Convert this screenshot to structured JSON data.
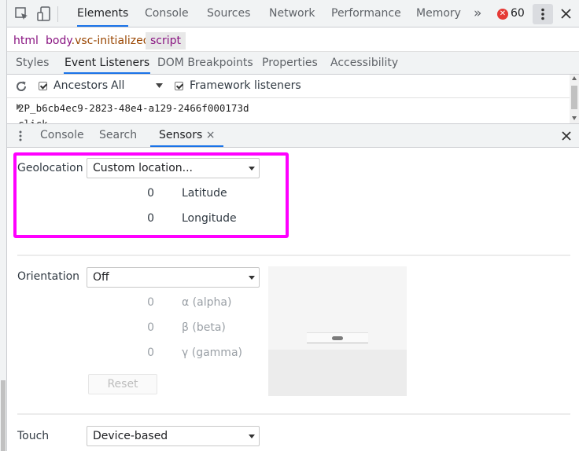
{
  "main_tabs": {
    "items": [
      "Elements",
      "Console",
      "Sources",
      "Network",
      "Performance",
      "Memory"
    ],
    "active": "Elements",
    "overflow": "»",
    "error_count": "60"
  },
  "breadcrumb": {
    "html": "html",
    "body_tag": "body",
    "body_class": ".vsc-initialized",
    "script": "script"
  },
  "sub_tabs": {
    "items": [
      "Styles",
      "Event Listeners",
      "DOM Breakpoints",
      "Properties",
      "Accessibility"
    ],
    "active": "Event Listeners"
  },
  "listeners": {
    "ancestors_label": "Ancestors",
    "ancestors_checked": true,
    "filter_value": "All",
    "framework_label": "Framework listeners",
    "framework_checked": true,
    "row_text": "2P_b6cb4ec9-2823-48e4-a129-2466f000173d",
    "row_text_partial": "click"
  },
  "drawer": {
    "items": [
      "Console",
      "Search",
      "Sensors"
    ],
    "active": "Sensors",
    "close_symbol": "×"
  },
  "sensors": {
    "geolocation": {
      "label": "Geolocation",
      "select_value": "Custom location...",
      "latitude_value": "0",
      "latitude_label": "Latitude",
      "longitude_value": "0",
      "longitude_label": "Longitude"
    },
    "orientation": {
      "label": "Orientation",
      "select_value": "Off",
      "alpha_value": "0",
      "alpha_label": "α (alpha)",
      "beta_value": "0",
      "beta_label": "β (beta)",
      "gamma_value": "0",
      "gamma_label": "γ (gamma)",
      "reset_label": "Reset"
    },
    "touch": {
      "label": "Touch",
      "select_value": "Device-based"
    }
  },
  "colors": {
    "highlight": "#ff00ff",
    "active_tab_underline": "#1a73e8",
    "error_badge": "#e53935"
  }
}
